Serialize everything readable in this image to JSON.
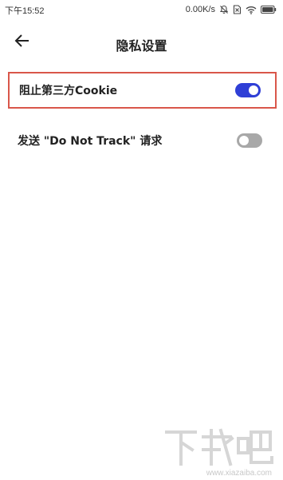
{
  "status_bar": {
    "time": "下午15:52",
    "net_speed": "0.00K/s",
    "icons": [
      "mute-bell-icon",
      "sim-x-icon",
      "wifi-icon",
      "battery-icon"
    ]
  },
  "header": {
    "title": "隐私设置",
    "back_icon": "back-arrow-icon"
  },
  "settings": [
    {
      "label": "阻止第三方Cookie",
      "toggle_on": true
    },
    {
      "label": "发送 \"Do Not Track\" 请求",
      "toggle_on": false
    }
  ],
  "colors": {
    "toggle_on": "#2f3fd6",
    "toggle_off": "#a8a8a8",
    "highlight_border": "#d9564a"
  },
  "watermark": {
    "logo_text": "下载吧",
    "url": "www.xiazaiba.com"
  }
}
